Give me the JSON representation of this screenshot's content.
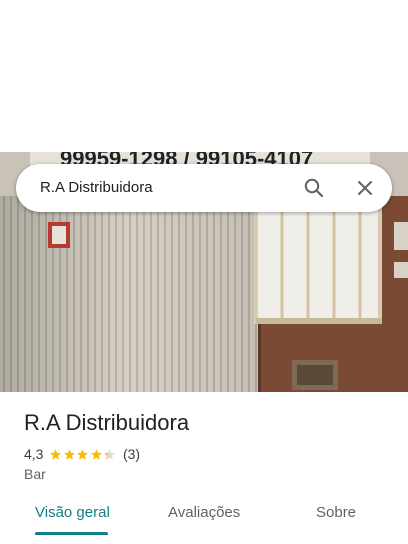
{
  "search": {
    "query": "R.A Distribuidora"
  },
  "place": {
    "name": "R.A Distribuidora",
    "rating": "4,3",
    "rating_value": 4.3,
    "review_count": "(3)",
    "category": "Bar"
  },
  "tabs": [
    {
      "label": "Visão geral",
      "active": true
    },
    {
      "label": "Avaliações",
      "active": false
    },
    {
      "label": "Sobre",
      "active": false
    }
  ],
  "photo": {
    "sign_text": "99959-1298 / 99105-4107"
  },
  "colors": {
    "accent": "#137f84",
    "star": "#fbbc04",
    "star_empty": "#dadce0",
    "wall": "#7a4a35"
  },
  "icons": {
    "search": "search-icon",
    "close": "close-icon",
    "star": "star-icon"
  }
}
